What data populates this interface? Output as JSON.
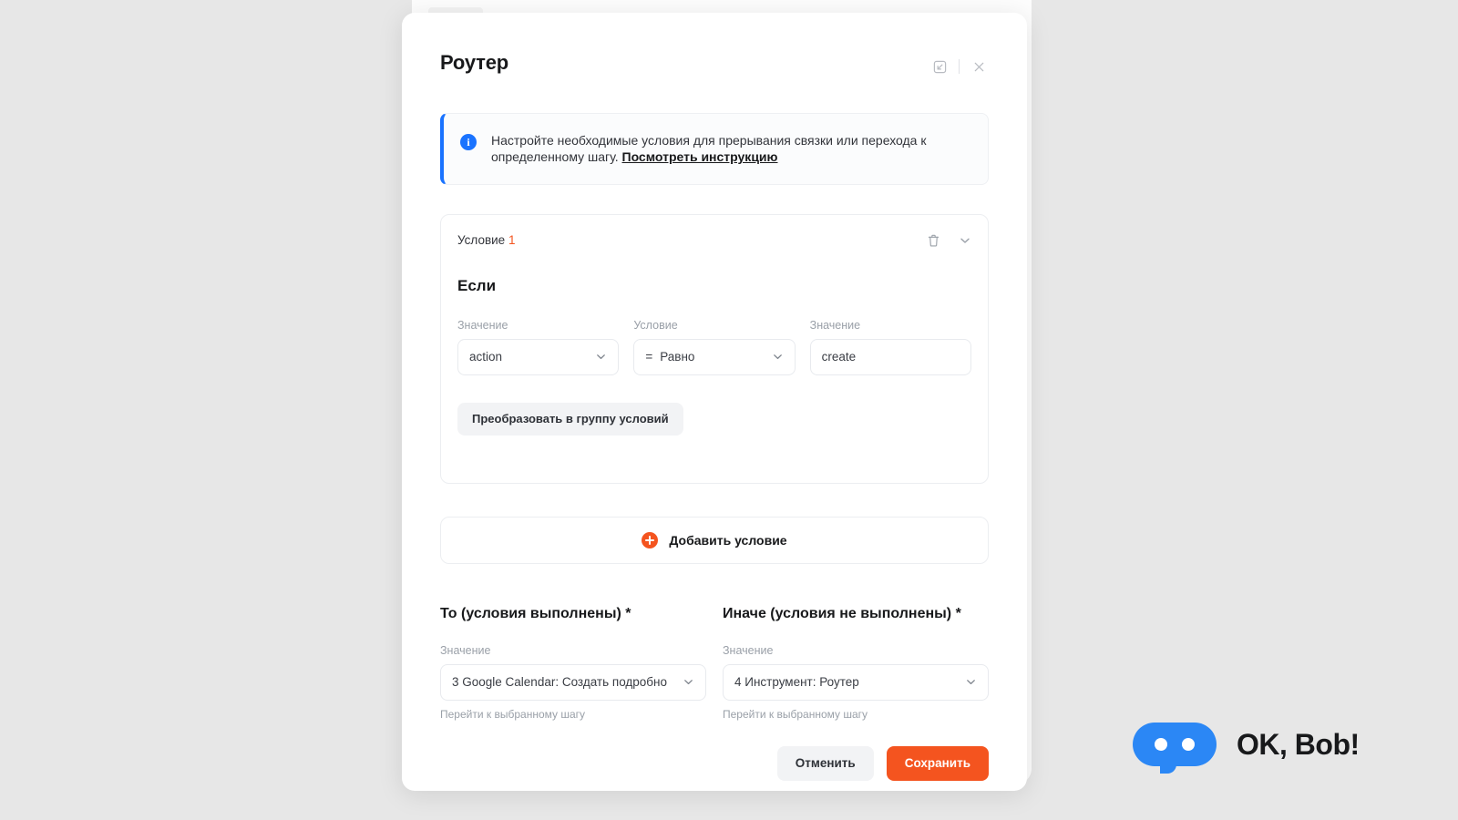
{
  "background": {
    "color": "#e7e7e7"
  },
  "modal": {
    "title": "Роутер",
    "header_icons": {
      "expand": "expand-arrow-box-icon",
      "close": "close-icon"
    },
    "info_banner": {
      "icon": "info-icon",
      "text": "Настройте необходимые условия для прерывания связки или перехода к определенному шагу. ",
      "link_text": "Посмотреть инструкцию",
      "accent_color": "#1a73ff"
    },
    "condition_card": {
      "label": "Условие",
      "number": "1",
      "number_color": "#f4541f",
      "delete_icon": "trash-icon",
      "collapse_icon": "chevron-down-icon",
      "if_title": "Если",
      "fields": [
        {
          "label": "Значение",
          "value": "action",
          "icon": "chevron-down-icon"
        },
        {
          "label": "Условие",
          "prefix": "=",
          "value": "Равно",
          "icon": "chevron-down-icon"
        },
        {
          "label": "Значение",
          "value": "create"
        }
      ],
      "group_button": "Преобразовать в группу условий"
    },
    "add_condition": {
      "icon": "plus-circle-icon",
      "label": "Добавить условие",
      "icon_color": "#f4541f"
    },
    "branches": [
      {
        "title": "То (условия выполнены) *",
        "field_label": "Значение",
        "value": "3 Google Calendar: Создать подробно",
        "helper": "Перейти к выбранному шагу",
        "icon": "chevron-down-icon"
      },
      {
        "title": "Иначе (условия не выполнены) *",
        "field_label": "Значение",
        "value": "4 Инструмент: Роутер",
        "helper": "Перейти к выбранному шагу",
        "icon": "chevron-down-icon"
      }
    ],
    "footer": {
      "cancel_label": "Отменить",
      "save_label": "Сохранить",
      "save_color": "#f4541f"
    }
  },
  "brand": {
    "text": "OK, Bob!",
    "mark_color": "#2b87f5"
  }
}
